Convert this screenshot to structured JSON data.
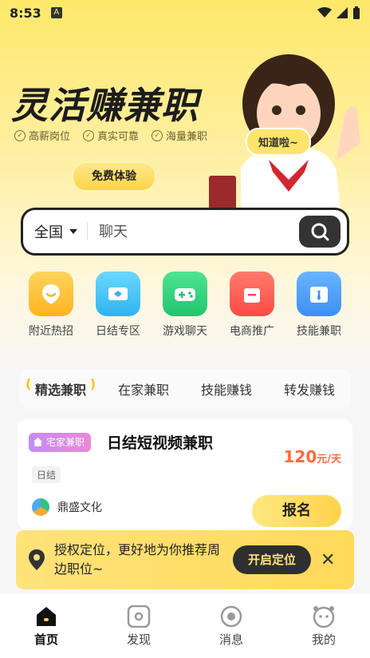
{
  "status_bar": {
    "time": "8:53",
    "a_badge": "A"
  },
  "banner": {
    "title": "灵活赚兼职",
    "tags": [
      "高薪岗位",
      "真实可靠",
      "海量兼职"
    ],
    "trial_button": "免费体验",
    "speech_bubble": "知道啦~"
  },
  "search": {
    "region": "全国",
    "placeholder": "聊天"
  },
  "categories": [
    {
      "label": "附近热招",
      "icon": "location-pin-icon",
      "color": "#ffbf1f"
    },
    {
      "label": "日结专区",
      "icon": "ticket-icon",
      "color": "#3fc0f5"
    },
    {
      "label": "游戏聊天",
      "icon": "gamepad-icon",
      "color": "#2ed47a"
    },
    {
      "label": "电商推广",
      "icon": "shopping-bag-icon",
      "color": "#ff5a4f"
    },
    {
      "label": "技能兼职",
      "icon": "briefcase-icon",
      "color": "#3c91f7"
    }
  ],
  "tabs": [
    "精选兼职",
    "在家兼职",
    "技能赚钱",
    "转发赚钱"
  ],
  "job": {
    "badge": "宅家兼职",
    "title": "日结短视频兼职",
    "salary": "120",
    "salary_unit": "元/天",
    "tag": "日结",
    "company": "鼎盛文化",
    "apply_button": "报名"
  },
  "location_prompt": {
    "text": "授权定位，更好地为你推荐周边职位~",
    "button": "开启定位"
  },
  "bottom_nav": [
    {
      "label": "首页",
      "icon": "home-icon",
      "active": true
    },
    {
      "label": "发现",
      "icon": "discover-icon",
      "active": false
    },
    {
      "label": "消息",
      "icon": "message-icon",
      "active": false
    },
    {
      "label": "我的",
      "icon": "profile-icon",
      "active": false
    }
  ]
}
